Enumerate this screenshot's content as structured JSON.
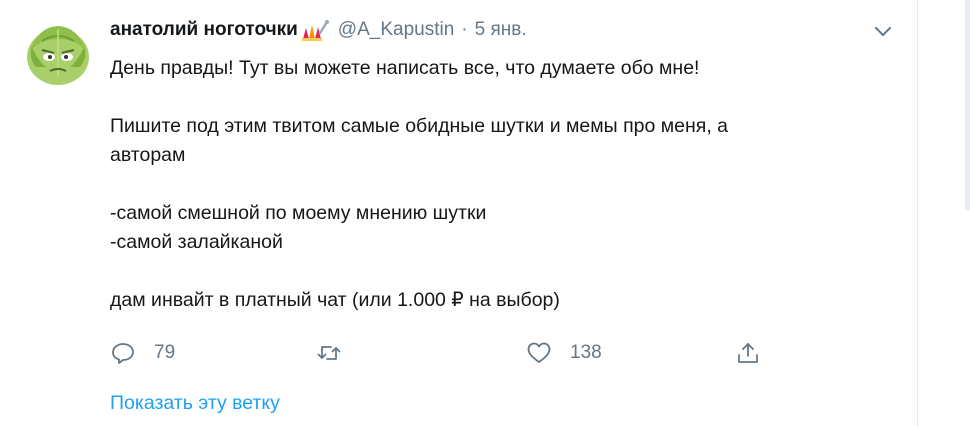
{
  "tweet": {
    "author_name": "анатолий ноготочки",
    "name_emoji_icon": "nails-emoji-icon",
    "handle": "@A_Kapustin",
    "separator": "·",
    "date": "5 янв.",
    "lines": [
      "День правды! Тут вы можете написать все, что думаете обо мне!",
      "",
      "Пишите под этим твитом самые обидные шутки и мемы про меня, а",
      "авторам",
      "",
      "-самой смешной по моему мнению шутки",
      "-самой залайканой",
      "",
      "дам инвайт в платный чат (или 1.000 ₽ на выбор)"
    ],
    "actions": {
      "reply_count": "79",
      "retweet_count": "",
      "like_count": "138"
    },
    "show_thread_label": "Показать эту ветку"
  },
  "colors": {
    "text": "#14171a",
    "secondary": "#657786",
    "link": "#1da1f2",
    "border": "#e6ecf0"
  }
}
